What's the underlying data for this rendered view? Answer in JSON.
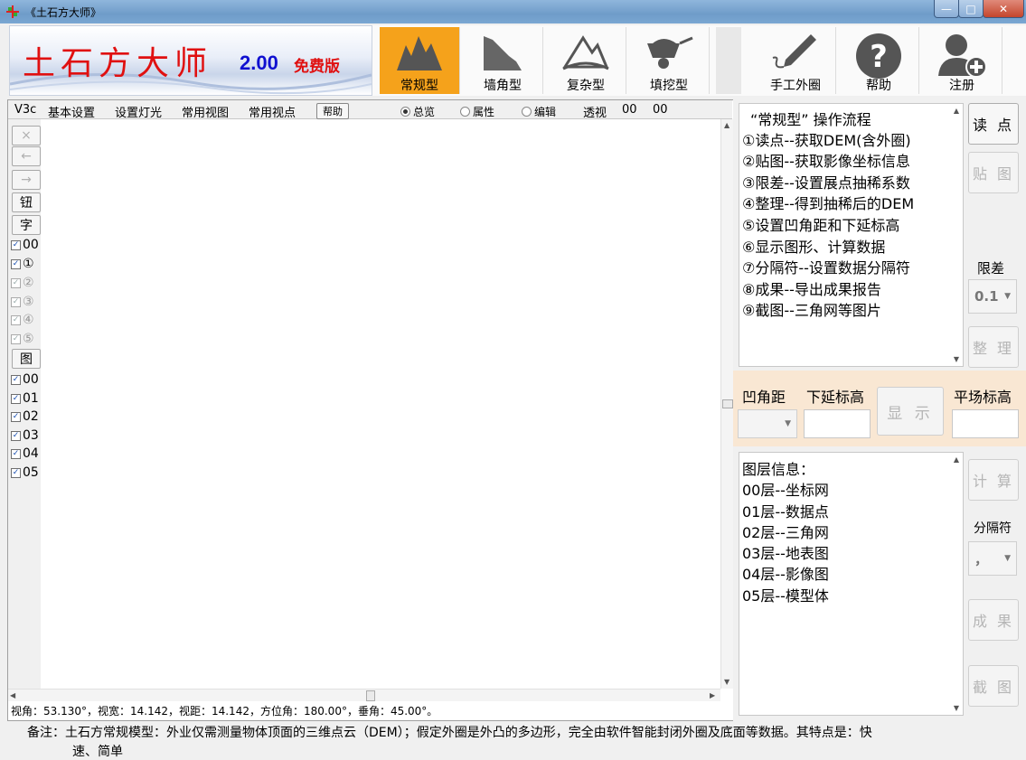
{
  "window": {
    "title": "《土石方大师》",
    "minimize": "—",
    "maximize": "□",
    "close": "✕"
  },
  "logo": {
    "name": "土石方大师",
    "version": "2.00",
    "edition": "免费版"
  },
  "toolbar": [
    {
      "label": "常规型",
      "icon": "mountain-icon"
    },
    {
      "label": "墙角型",
      "icon": "slope-icon"
    },
    {
      "label": "复杂型",
      "icon": "complex-terrain-icon"
    },
    {
      "label": "填挖型",
      "icon": "wheelbarrow-icon"
    },
    {
      "label": "手工外圈",
      "icon": "pen-icon"
    },
    {
      "label": "帮助",
      "icon": "question-icon"
    },
    {
      "label": "注册",
      "icon": "add-user-icon"
    }
  ],
  "menubar": {
    "v3": "V3c",
    "items": [
      "基本设置",
      "设置灯光",
      "常用视图",
      "常用视点"
    ],
    "help": "帮助",
    "radios": [
      {
        "label": "总览",
        "selected": true
      },
      {
        "label": "属性",
        "selected": false
      },
      {
        "label": "编辑",
        "selected": false
      }
    ],
    "perspective": "透视",
    "val1": "00",
    "val2": "00"
  },
  "leftcol": {
    "buttons": [
      "×",
      "←",
      "→",
      "钮",
      "字"
    ],
    "checks_a": [
      {
        "label": "00",
        "checked": true,
        "enabled": true
      },
      {
        "label": "①",
        "checked": true,
        "enabled": true
      },
      {
        "label": "②",
        "checked": true,
        "enabled": false
      },
      {
        "label": "③",
        "checked": true,
        "enabled": false
      },
      {
        "label": "④",
        "checked": true,
        "enabled": false
      },
      {
        "label": "⑤",
        "checked": true,
        "enabled": false
      }
    ],
    "figure_button": "图",
    "checks_b": [
      "00",
      "01",
      "02",
      "03",
      "04",
      "05"
    ]
  },
  "status": "视角：53.130°，视宽：14.142，视距：14.142，方位角：180.00°，垂角：45.00°。",
  "note": {
    "line1": "备注：土石方常规模型：外业仅需测量物体顶面的三维点云（DEM）；假定外圈是外凸的多边形，完全由软件智能封闭外圈及底面等数据。其特点是：快",
    "line2": "速、简单"
  },
  "procedure": {
    "title": "“常规型” 操作流程",
    "steps": [
      "①读点--获取DEM(含外圈)",
      "②贴图--获取影像坐标信息",
      "③限差--设置展点抽稀系数",
      "④整理--得到抽稀后的DEM",
      "⑤设置凹角距和下延标高",
      "⑥显示图形、计算数据",
      "⑦分隔符--设置数据分隔符",
      "⑧成果--导出成果报告",
      "⑨截图--三角网等图片"
    ]
  },
  "right_buttons": {
    "read": "读 点",
    "paste": "贴 图",
    "limit_label": "限差",
    "limit_value": "0.1",
    "tidy": "整 理",
    "calc": "计 算",
    "sep_label": "分隔符",
    "sep_value": "，",
    "result": "成 果",
    "screenshot": "截 图"
  },
  "params": {
    "concave": "凹角距",
    "lower": "下延标高",
    "show": "显 示",
    "flat": "平场标高"
  },
  "layers": {
    "title": "图层信息：",
    "items": [
      "00层--坐标网",
      "01层--数据点",
      "02层--三角网",
      "03层--地表图",
      "04层--影像图",
      "05层--模型体"
    ]
  }
}
